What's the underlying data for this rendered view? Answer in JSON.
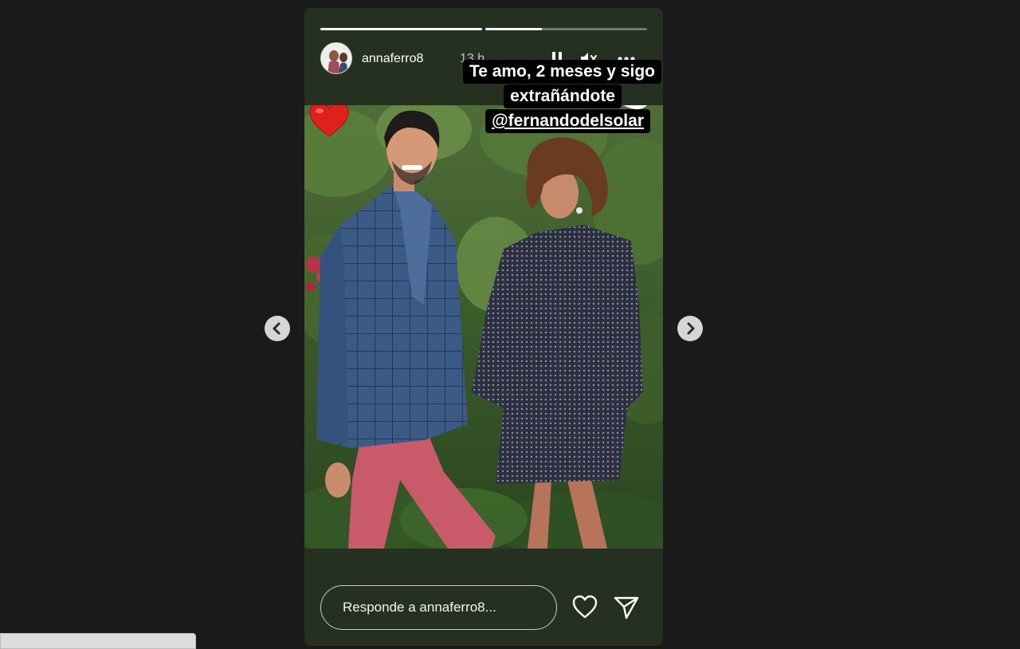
{
  "story": {
    "username": "annaferro8",
    "timestamp": "13 h",
    "progress": [
      1.0,
      0.35
    ],
    "caption_lines": [
      "Te amo, 2 meses y sigo",
      "extrañándote",
      "@fernandodelsolar"
    ],
    "sticker": "heart-emoji"
  },
  "reply": {
    "placeholder": "Responde a annaferro8..."
  },
  "icons": {
    "pause": "pause-icon",
    "mute": "speaker-muted-icon",
    "more": "more-horizontal-icon",
    "like": "heart-outline-icon",
    "send": "send-paper-plane-icon",
    "prev": "chevron-left-icon",
    "next": "chevron-right-icon"
  },
  "colors": {
    "page_background": "#1a1a1a",
    "story_background": "#253021",
    "caption_background": "#000000",
    "text": "#ffffff",
    "heart": "#e0201c"
  }
}
